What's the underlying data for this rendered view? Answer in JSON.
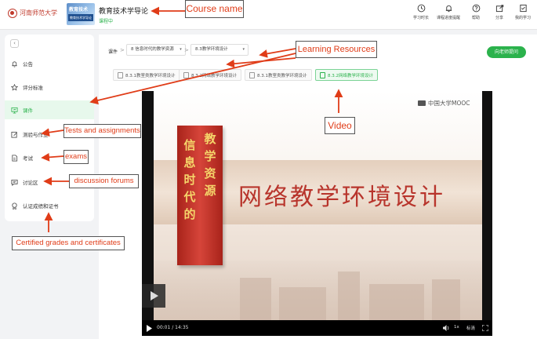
{
  "header": {
    "university_name": "河南师范大学",
    "thumbnail_line1": "教育技术",
    "thumbnail_line2": "教育技术学导论",
    "course_title": "教育技术学导论",
    "course_status": "课程中",
    "tools": [
      {
        "label": "学习时长",
        "icon": "clock-icon"
      },
      {
        "label": "课程进度提醒",
        "icon": "bell-lock-icon"
      },
      {
        "label": "帮助",
        "icon": "help-icon"
      },
      {
        "label": "分享",
        "icon": "share-icon"
      },
      {
        "label": "我的学习",
        "icon": "checklist-icon"
      }
    ]
  },
  "sidebar": {
    "collapse_symbol": "‹",
    "items": [
      {
        "label": "公告",
        "icon": "bell-icon",
        "active": false
      },
      {
        "label": "评分标准",
        "icon": "star-icon",
        "active": false
      },
      {
        "label": "课件",
        "icon": "courseware-icon",
        "active": true
      },
      {
        "label": "测验与作业",
        "icon": "edit-icon",
        "active": false
      },
      {
        "label": "考试",
        "icon": "exam-icon",
        "active": false
      },
      {
        "label": "讨论区",
        "icon": "chat-icon",
        "active": false
      },
      {
        "label": "认证成绩和证书",
        "icon": "certificate-icon",
        "active": false
      }
    ]
  },
  "breadcrumb": {
    "label": "课件",
    "separator": ">",
    "chapter": "8 信息时代的教学资源",
    "section": "8.3教学环境设计",
    "caret": "▾"
  },
  "teacher_button": "向老师提问",
  "resource_tabs": [
    {
      "label": "8.3.1教室类教学环境设计",
      "active": false
    },
    {
      "label": "8.3.2网络教学环境设计",
      "active": false
    },
    {
      "label": "8.3.1教室类教学环境设计",
      "active": false
    },
    {
      "label": "8.3.2网络教学环境设计",
      "active": true
    }
  ],
  "video": {
    "watermark": "中国大学MOOC",
    "slide_title": "网络教学环境设计",
    "banner_col_left": "信息时代的",
    "banner_col_right": "教学资源",
    "current_time": "00:01",
    "time_separator": "/",
    "total_time": "14:35",
    "speed_label": "1x",
    "quality_label": "标清"
  },
  "annotations": {
    "course_name": "Course name",
    "learning_resources": "Learning Resources",
    "tests_assignments": "Tests and assignments",
    "exams": "exams",
    "discussion_forums": "discussion forums",
    "video": "Video",
    "certified": "Certified grades and certificates"
  },
  "colors": {
    "accent_green": "#2bb24c",
    "annotation_red": "#e03c18",
    "banner_red": "#c0392b"
  }
}
